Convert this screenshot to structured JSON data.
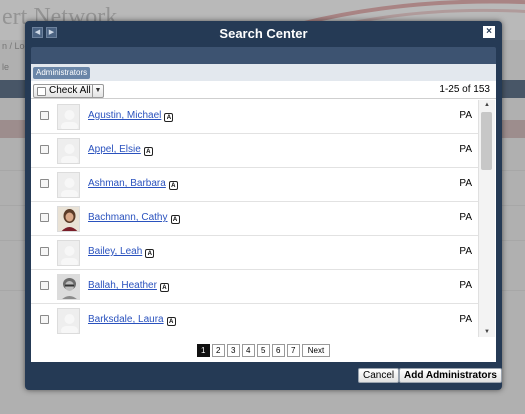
{
  "background": {
    "site_title": "ert Network",
    "breadcrumb": "n / Log",
    "tab_fragment": "le"
  },
  "modal": {
    "title": "Search Center",
    "close_label": "×",
    "nav_prev": "◀",
    "nav_next": "▶",
    "filter_chip": "Administrators",
    "check_all_label": "Check All",
    "range_text": "1-25 of 153",
    "rows": [
      {
        "name": "Agustin, Michael",
        "state": "PA",
        "photo": "placeholder"
      },
      {
        "name": "Appel, Elsie",
        "state": "PA",
        "photo": "placeholder"
      },
      {
        "name": "Ashman, Barbara",
        "state": "PA",
        "photo": "placeholder"
      },
      {
        "name": "Bachmann, Cathy",
        "state": "PA",
        "photo": "photo-woman"
      },
      {
        "name": "Bailey, Leah",
        "state": "PA",
        "photo": "placeholder"
      },
      {
        "name": "Ballah, Heather",
        "state": "PA",
        "photo": "photo-bw"
      },
      {
        "name": "Barksdale, Laura",
        "state": "PA",
        "photo": "placeholder"
      }
    ],
    "admin_icon_glyph": "A",
    "pagination": {
      "pages": [
        "1",
        "2",
        "3",
        "4",
        "5",
        "6",
        "7"
      ],
      "current": "1",
      "next_label": "Next"
    },
    "buttons": {
      "cancel": "Cancel",
      "add": "Add Administrators"
    }
  },
  "colors": {
    "modal_frame": "#253a55",
    "link": "#2a52be",
    "chip": "#6a86a8"
  }
}
